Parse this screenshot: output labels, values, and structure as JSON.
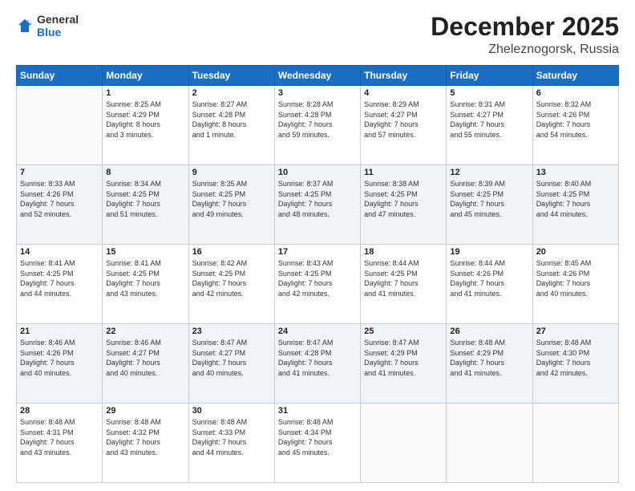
{
  "header": {
    "logo_general": "General",
    "logo_blue": "Blue",
    "month": "December 2025",
    "location": "Zheleznogorsk, Russia"
  },
  "days_of_week": [
    "Sunday",
    "Monday",
    "Tuesday",
    "Wednesday",
    "Thursday",
    "Friday",
    "Saturday"
  ],
  "weeks": [
    [
      {
        "day": "",
        "info": ""
      },
      {
        "day": "1",
        "info": "Sunrise: 8:25 AM\nSunset: 4:29 PM\nDaylight: 8 hours\nand 3 minutes."
      },
      {
        "day": "2",
        "info": "Sunrise: 8:27 AM\nSunset: 4:28 PM\nDaylight: 8 hours\nand 1 minute."
      },
      {
        "day": "3",
        "info": "Sunrise: 8:28 AM\nSunset: 4:28 PM\nDaylight: 7 hours\nand 59 minutes."
      },
      {
        "day": "4",
        "info": "Sunrise: 8:29 AM\nSunset: 4:27 PM\nDaylight: 7 hours\nand 57 minutes."
      },
      {
        "day": "5",
        "info": "Sunrise: 8:31 AM\nSunset: 4:27 PM\nDaylight: 7 hours\nand 55 minutes."
      },
      {
        "day": "6",
        "info": "Sunrise: 8:32 AM\nSunset: 4:26 PM\nDaylight: 7 hours\nand 54 minutes."
      }
    ],
    [
      {
        "day": "7",
        "info": "Sunrise: 8:33 AM\nSunset: 4:26 PM\nDaylight: 7 hours\nand 52 minutes."
      },
      {
        "day": "8",
        "info": "Sunrise: 8:34 AM\nSunset: 4:25 PM\nDaylight: 7 hours\nand 51 minutes."
      },
      {
        "day": "9",
        "info": "Sunrise: 8:35 AM\nSunset: 4:25 PM\nDaylight: 7 hours\nand 49 minutes."
      },
      {
        "day": "10",
        "info": "Sunrise: 8:37 AM\nSunset: 4:25 PM\nDaylight: 7 hours\nand 48 minutes."
      },
      {
        "day": "11",
        "info": "Sunrise: 8:38 AM\nSunset: 4:25 PM\nDaylight: 7 hours\nand 47 minutes."
      },
      {
        "day": "12",
        "info": "Sunrise: 8:39 AM\nSunset: 4:25 PM\nDaylight: 7 hours\nand 45 minutes."
      },
      {
        "day": "13",
        "info": "Sunrise: 8:40 AM\nSunset: 4:25 PM\nDaylight: 7 hours\nand 44 minutes."
      }
    ],
    [
      {
        "day": "14",
        "info": "Sunrise: 8:41 AM\nSunset: 4:25 PM\nDaylight: 7 hours\nand 44 minutes."
      },
      {
        "day": "15",
        "info": "Sunrise: 8:41 AM\nSunset: 4:25 PM\nDaylight: 7 hours\nand 43 minutes."
      },
      {
        "day": "16",
        "info": "Sunrise: 8:42 AM\nSunset: 4:25 PM\nDaylight: 7 hours\nand 42 minutes."
      },
      {
        "day": "17",
        "info": "Sunrise: 8:43 AM\nSunset: 4:25 PM\nDaylight: 7 hours\nand 42 minutes."
      },
      {
        "day": "18",
        "info": "Sunrise: 8:44 AM\nSunset: 4:25 PM\nDaylight: 7 hours\nand 41 minutes."
      },
      {
        "day": "19",
        "info": "Sunrise: 8:44 AM\nSunset: 4:26 PM\nDaylight: 7 hours\nand 41 minutes."
      },
      {
        "day": "20",
        "info": "Sunrise: 8:45 AM\nSunset: 4:26 PM\nDaylight: 7 hours\nand 40 minutes."
      }
    ],
    [
      {
        "day": "21",
        "info": "Sunrise: 8:46 AM\nSunset: 4:26 PM\nDaylight: 7 hours\nand 40 minutes."
      },
      {
        "day": "22",
        "info": "Sunrise: 8:46 AM\nSunset: 4:27 PM\nDaylight: 7 hours\nand 40 minutes."
      },
      {
        "day": "23",
        "info": "Sunrise: 8:47 AM\nSunset: 4:27 PM\nDaylight: 7 hours\nand 40 minutes."
      },
      {
        "day": "24",
        "info": "Sunrise: 8:47 AM\nSunset: 4:28 PM\nDaylight: 7 hours\nand 41 minutes."
      },
      {
        "day": "25",
        "info": "Sunrise: 8:47 AM\nSunset: 4:29 PM\nDaylight: 7 hours\nand 41 minutes."
      },
      {
        "day": "26",
        "info": "Sunrise: 8:48 AM\nSunset: 4:29 PM\nDaylight: 7 hours\nand 41 minutes."
      },
      {
        "day": "27",
        "info": "Sunrise: 8:48 AM\nSunset: 4:30 PM\nDaylight: 7 hours\nand 42 minutes."
      }
    ],
    [
      {
        "day": "28",
        "info": "Sunrise: 8:48 AM\nSunset: 4:31 PM\nDaylight: 7 hours\nand 43 minutes."
      },
      {
        "day": "29",
        "info": "Sunrise: 8:48 AM\nSunset: 4:32 PM\nDaylight: 7 hours\nand 43 minutes."
      },
      {
        "day": "30",
        "info": "Sunrise: 8:48 AM\nSunset: 4:33 PM\nDaylight: 7 hours\nand 44 minutes."
      },
      {
        "day": "31",
        "info": "Sunrise: 8:48 AM\nSunset: 4:34 PM\nDaylight: 7 hours\nand 45 minutes."
      },
      {
        "day": "",
        "info": ""
      },
      {
        "day": "",
        "info": ""
      },
      {
        "day": "",
        "info": ""
      }
    ]
  ],
  "row_shades": [
    false,
    true,
    false,
    true,
    false
  ]
}
